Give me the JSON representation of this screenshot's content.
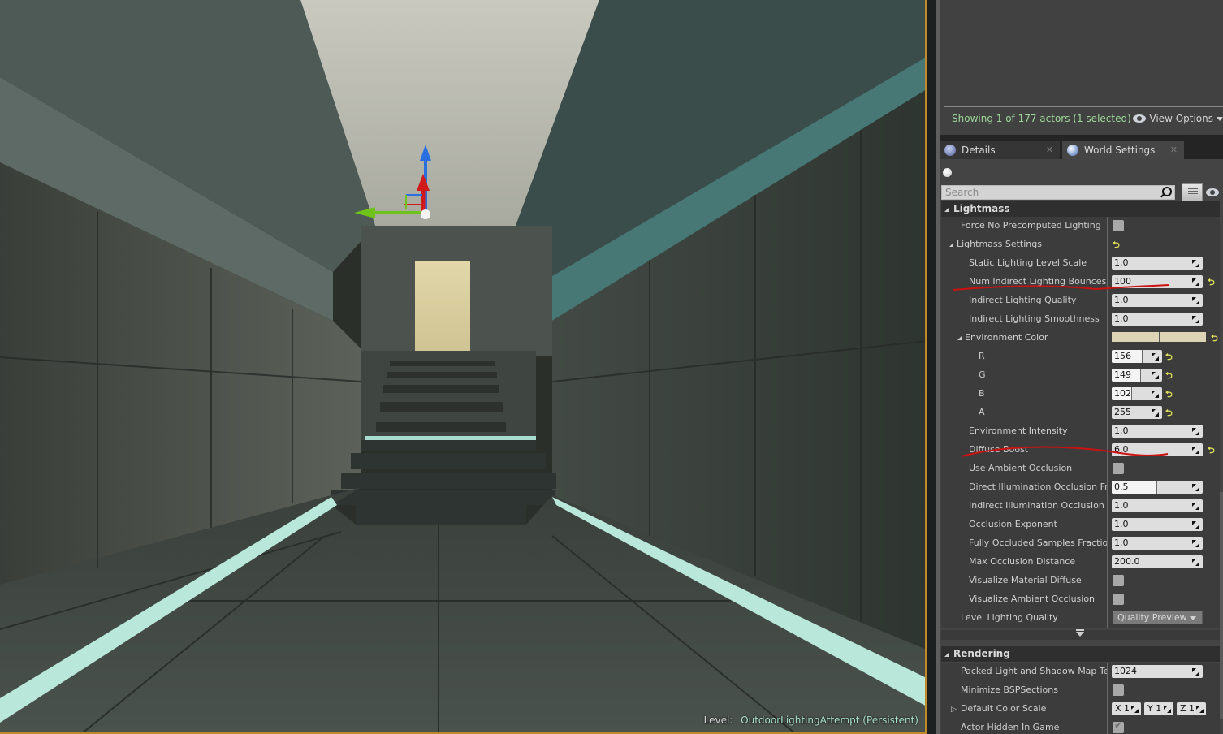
{
  "viewport": {
    "level_prefix": "Level:",
    "level_name": "OutdoorLightingAttempt (Persistent)",
    "gizmo_colors": {
      "x": "#d11a1a",
      "y": "#6fc21a",
      "z": "#2a6fe0"
    }
  },
  "outliner": {
    "actor_count": "Showing 1 of 177 actors (1 selected)",
    "view_options": "View Options"
  },
  "tabs": [
    {
      "label": "Details",
      "active": false,
      "icon": "info-icon"
    },
    {
      "label": "World Settings",
      "active": true,
      "icon": "globe-icon"
    }
  ],
  "details": {
    "search_placeholder": "Search",
    "sections": {
      "lightmass": {
        "title": "Lightmass",
        "force_no_precomputed": {
          "label": "Force No Precomputed Lighting",
          "checked": false
        },
        "lightmass_settings": {
          "label": "Lightmass Settings"
        },
        "static_lighting_level_scale": {
          "label": "Static Lighting Level Scale",
          "value": "1.0"
        },
        "num_indirect_bounces": {
          "label": "Num Indirect Lighting Bounces",
          "value": "100"
        },
        "indirect_lighting_quality": {
          "label": "Indirect Lighting Quality",
          "value": "1.0"
        },
        "indirect_lighting_smoothness": {
          "label": "Indirect Lighting Smoothness",
          "value": "1.0"
        },
        "environment_color": {
          "label": "Environment Color",
          "hex": "#9C9566",
          "r": {
            "label": "R",
            "value": "156",
            "fraction": 0.61
          },
          "g": {
            "label": "G",
            "value": "149",
            "fraction": 0.58
          },
          "b": {
            "label": "B",
            "value": "102",
            "fraction": 0.4
          },
          "a": {
            "label": "A",
            "value": "255",
            "fraction": 1.0
          }
        },
        "environment_intensity": {
          "label": "Environment Intensity",
          "value": "1.0"
        },
        "diffuse_boost": {
          "label": "Diffuse Boost",
          "value": "6.0"
        },
        "use_ambient_occlusion": {
          "label": "Use Ambient Occlusion",
          "checked": false
        },
        "direct_illum_occlusion": {
          "label": "Direct Illumination Occlusion Fraction",
          "value": "0.5",
          "fraction": 0.5
        },
        "indirect_illum_occlusion": {
          "label": "Indirect Illumination Occlusion Fraction",
          "value": "1.0"
        },
        "occlusion_exponent": {
          "label": "Occlusion Exponent",
          "value": "1.0"
        },
        "fully_occluded_samples": {
          "label": "Fully Occluded Samples Fraction",
          "value": "1.0"
        },
        "max_occlusion_distance": {
          "label": "Max Occlusion Distance",
          "value": "200.0"
        },
        "visualize_material_diffuse": {
          "label": "Visualize Material Diffuse",
          "checked": false
        },
        "visualize_ambient_occlusion": {
          "label": "Visualize Ambient Occlusion",
          "checked": false
        },
        "level_lighting_quality": {
          "label": "Level Lighting Quality",
          "value": "Quality Preview"
        }
      },
      "rendering": {
        "title": "Rendering",
        "packed_light_shadow": {
          "label": "Packed Light and Shadow Map Texture Size",
          "value": "1024"
        },
        "minimize_bsp": {
          "label": "Minimize BSPSections",
          "checked": false
        },
        "default_color_scale": {
          "label": "Default Color Scale",
          "x": "X 1",
          "y": "Y 1",
          "z": "Z 1"
        },
        "actor_hidden_in_game": {
          "label": "Actor Hidden In Game",
          "checked": true
        }
      }
    },
    "reset_glyph": "⮌",
    "annotation_color": "#cc1111"
  }
}
